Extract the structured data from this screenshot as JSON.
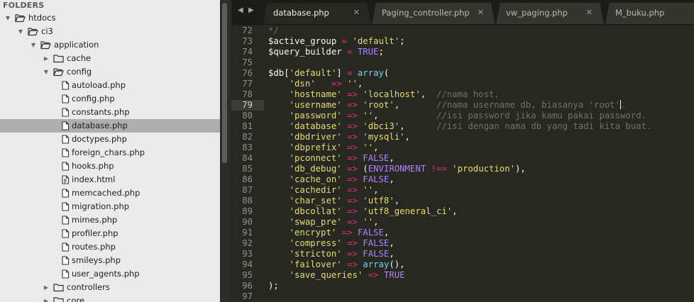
{
  "sidebar": {
    "header": "FOLDERS",
    "tree": [
      {
        "label": "htdocs",
        "type": "folder",
        "expanded": true,
        "depth": 0
      },
      {
        "label": "ci3",
        "type": "folder",
        "expanded": true,
        "depth": 1
      },
      {
        "label": "application",
        "type": "folder",
        "expanded": true,
        "depth": 2
      },
      {
        "label": "cache",
        "type": "folder",
        "expanded": false,
        "depth": 3
      },
      {
        "label": "config",
        "type": "folder",
        "expanded": true,
        "depth": 3
      },
      {
        "label": "autoload.php",
        "type": "file",
        "depth": 4
      },
      {
        "label": "config.php",
        "type": "file",
        "depth": 4
      },
      {
        "label": "constants.php",
        "type": "file",
        "depth": 4
      },
      {
        "label": "database.php",
        "type": "file",
        "depth": 4,
        "selected": true
      },
      {
        "label": "doctypes.php",
        "type": "file",
        "depth": 4
      },
      {
        "label": "foreign_chars.php",
        "type": "file",
        "depth": 4
      },
      {
        "label": "hooks.php",
        "type": "file",
        "depth": 4
      },
      {
        "label": "index.html",
        "type": "html",
        "depth": 4
      },
      {
        "label": "memcached.php",
        "type": "file",
        "depth": 4
      },
      {
        "label": "migration.php",
        "type": "file",
        "depth": 4
      },
      {
        "label": "mimes.php",
        "type": "file",
        "depth": 4
      },
      {
        "label": "profiler.php",
        "type": "file",
        "depth": 4
      },
      {
        "label": "routes.php",
        "type": "file",
        "depth": 4
      },
      {
        "label": "smileys.php",
        "type": "file",
        "depth": 4
      },
      {
        "label": "user_agents.php",
        "type": "file",
        "depth": 4
      },
      {
        "label": "controllers",
        "type": "folder",
        "expanded": false,
        "depth": 3
      },
      {
        "label": "core",
        "type": "folder",
        "expanded": false,
        "depth": 3
      }
    ]
  },
  "tabs": [
    {
      "label": "database.php",
      "active": true
    },
    {
      "label": "Paging_controller.php",
      "active": false
    },
    {
      "label": "vw_paging.php",
      "active": false
    },
    {
      "label": "M_buku.php",
      "active": false
    }
  ],
  "icons": {
    "nav_left": "◀",
    "nav_right": "▶",
    "close": "✕",
    "arrow_expanded": "▼",
    "arrow_collapsed": "▶"
  },
  "colors": {
    "string": "#e6db74",
    "keyword": "#ae81ff",
    "operator": "#f92672",
    "function": "#66d9ef",
    "comment": "#75715e",
    "plain": "#f8f8f2"
  },
  "editor": {
    "current_line": 79,
    "lines": [
      {
        "n": "72",
        "t": [
          [
            "*/",
            "comment"
          ]
        ]
      },
      {
        "n": "73",
        "t": [
          [
            "$active_group ",
            "plain"
          ],
          [
            "=",
            "operator"
          ],
          [
            " ",
            "plain"
          ],
          [
            "'default'",
            "string"
          ],
          [
            ";",
            "plain"
          ]
        ]
      },
      {
        "n": "74",
        "t": [
          [
            "$query_builder ",
            "plain"
          ],
          [
            "=",
            "operator"
          ],
          [
            " ",
            "plain"
          ],
          [
            "TRUE",
            "keyword"
          ],
          [
            ";",
            "plain"
          ]
        ]
      },
      {
        "n": "75",
        "t": []
      },
      {
        "n": "76",
        "t": [
          [
            "$db[",
            "plain"
          ],
          [
            "'default'",
            "string"
          ],
          [
            "] ",
            "plain"
          ],
          [
            "=",
            "operator"
          ],
          [
            " ",
            "plain"
          ],
          [
            "array",
            "function"
          ],
          [
            "(",
            "plain"
          ]
        ]
      },
      {
        "n": "77",
        "t": [
          [
            "    ",
            "plain"
          ],
          [
            "'dsn'",
            "string"
          ],
          [
            "   ",
            "plain"
          ],
          [
            "=>",
            "operator"
          ],
          [
            " ",
            "plain"
          ],
          [
            "''",
            "string"
          ],
          [
            ",",
            "plain"
          ]
        ]
      },
      {
        "n": "78",
        "t": [
          [
            "    ",
            "plain"
          ],
          [
            "'hostname'",
            "string"
          ],
          [
            " ",
            "plain"
          ],
          [
            "=>",
            "operator"
          ],
          [
            " ",
            "plain"
          ],
          [
            "'localhost'",
            "string"
          ],
          [
            ",  ",
            "plain"
          ],
          [
            "//nama host.",
            "comment"
          ]
        ]
      },
      {
        "n": "79",
        "t": [
          [
            "    ",
            "plain"
          ],
          [
            "'username'",
            "string"
          ],
          [
            " ",
            "plain"
          ],
          [
            "=>",
            "operator"
          ],
          [
            " ",
            "plain"
          ],
          [
            "'root'",
            "string"
          ],
          [
            ",       ",
            "plain"
          ],
          [
            "//nama username db, biasanya 'root'",
            "comment"
          ],
          [
            "|cursor|",
            "cursor"
          ],
          [
            ".",
            "comment"
          ]
        ]
      },
      {
        "n": "80",
        "t": [
          [
            "    ",
            "plain"
          ],
          [
            "'password'",
            "string"
          ],
          [
            " ",
            "plain"
          ],
          [
            "=>",
            "operator"
          ],
          [
            " ",
            "plain"
          ],
          [
            "''",
            "string"
          ],
          [
            ",           ",
            "plain"
          ],
          [
            "//isi password jika kamu pakai password.",
            "comment"
          ]
        ]
      },
      {
        "n": "81",
        "t": [
          [
            "    ",
            "plain"
          ],
          [
            "'database'",
            "string"
          ],
          [
            " ",
            "plain"
          ],
          [
            "=>",
            "operator"
          ],
          [
            " ",
            "plain"
          ],
          [
            "'dbci3'",
            "string"
          ],
          [
            ",      ",
            "plain"
          ],
          [
            "//isi dengan nama db yang tadi kita buat.",
            "comment"
          ]
        ]
      },
      {
        "n": "82",
        "t": [
          [
            "    ",
            "plain"
          ],
          [
            "'dbdriver'",
            "string"
          ],
          [
            " ",
            "plain"
          ],
          [
            "=>",
            "operator"
          ],
          [
            " ",
            "plain"
          ],
          [
            "'mysqli'",
            "string"
          ],
          [
            ",",
            "plain"
          ]
        ]
      },
      {
        "n": "83",
        "t": [
          [
            "    ",
            "plain"
          ],
          [
            "'dbprefix'",
            "string"
          ],
          [
            " ",
            "plain"
          ],
          [
            "=>",
            "operator"
          ],
          [
            " ",
            "plain"
          ],
          [
            "''",
            "string"
          ],
          [
            ",",
            "plain"
          ]
        ]
      },
      {
        "n": "84",
        "t": [
          [
            "    ",
            "plain"
          ],
          [
            "'pconnect'",
            "string"
          ],
          [
            " ",
            "plain"
          ],
          [
            "=>",
            "operator"
          ],
          [
            " ",
            "plain"
          ],
          [
            "FALSE",
            "keyword"
          ],
          [
            ",",
            "plain"
          ]
        ]
      },
      {
        "n": "85",
        "t": [
          [
            "    ",
            "plain"
          ],
          [
            "'db_debug'",
            "string"
          ],
          [
            " ",
            "plain"
          ],
          [
            "=>",
            "operator"
          ],
          [
            " (",
            "plain"
          ],
          [
            "ENVIRONMENT",
            "keyword"
          ],
          [
            " ",
            "plain"
          ],
          [
            "!==",
            "operator"
          ],
          [
            " ",
            "plain"
          ],
          [
            "'production'",
            "string"
          ],
          [
            "),",
            "plain"
          ]
        ]
      },
      {
        "n": "86",
        "t": [
          [
            "    ",
            "plain"
          ],
          [
            "'cache_on'",
            "string"
          ],
          [
            " ",
            "plain"
          ],
          [
            "=>",
            "operator"
          ],
          [
            " ",
            "plain"
          ],
          [
            "FALSE",
            "keyword"
          ],
          [
            ",",
            "plain"
          ]
        ]
      },
      {
        "n": "87",
        "t": [
          [
            "    ",
            "plain"
          ],
          [
            "'cachedir'",
            "string"
          ],
          [
            " ",
            "plain"
          ],
          [
            "=>",
            "operator"
          ],
          [
            " ",
            "plain"
          ],
          [
            "''",
            "string"
          ],
          [
            ",",
            "plain"
          ]
        ]
      },
      {
        "n": "88",
        "t": [
          [
            "    ",
            "plain"
          ],
          [
            "'char_set'",
            "string"
          ],
          [
            " ",
            "plain"
          ],
          [
            "=>",
            "operator"
          ],
          [
            " ",
            "plain"
          ],
          [
            "'utf8'",
            "string"
          ],
          [
            ",",
            "plain"
          ]
        ]
      },
      {
        "n": "89",
        "t": [
          [
            "    ",
            "plain"
          ],
          [
            "'dbcollat'",
            "string"
          ],
          [
            " ",
            "plain"
          ],
          [
            "=>",
            "operator"
          ],
          [
            " ",
            "plain"
          ],
          [
            "'utf8_general_ci'",
            "string"
          ],
          [
            ",",
            "plain"
          ]
        ]
      },
      {
        "n": "90",
        "t": [
          [
            "    ",
            "plain"
          ],
          [
            "'swap_pre'",
            "string"
          ],
          [
            " ",
            "plain"
          ],
          [
            "=>",
            "operator"
          ],
          [
            " ",
            "plain"
          ],
          [
            "''",
            "string"
          ],
          [
            ",",
            "plain"
          ]
        ]
      },
      {
        "n": "91",
        "t": [
          [
            "    ",
            "plain"
          ],
          [
            "'encrypt'",
            "string"
          ],
          [
            " ",
            "plain"
          ],
          [
            "=>",
            "operator"
          ],
          [
            " ",
            "plain"
          ],
          [
            "FALSE",
            "keyword"
          ],
          [
            ",",
            "plain"
          ]
        ]
      },
      {
        "n": "92",
        "t": [
          [
            "    ",
            "plain"
          ],
          [
            "'compress'",
            "string"
          ],
          [
            " ",
            "plain"
          ],
          [
            "=>",
            "operator"
          ],
          [
            " ",
            "plain"
          ],
          [
            "FALSE",
            "keyword"
          ],
          [
            ",",
            "plain"
          ]
        ]
      },
      {
        "n": "93",
        "t": [
          [
            "    ",
            "plain"
          ],
          [
            "'stricton'",
            "string"
          ],
          [
            " ",
            "plain"
          ],
          [
            "=>",
            "operator"
          ],
          [
            " ",
            "plain"
          ],
          [
            "FALSE",
            "keyword"
          ],
          [
            ",",
            "plain"
          ]
        ]
      },
      {
        "n": "94",
        "t": [
          [
            "    ",
            "plain"
          ],
          [
            "'failover'",
            "string"
          ],
          [
            " ",
            "plain"
          ],
          [
            "=>",
            "operator"
          ],
          [
            " ",
            "plain"
          ],
          [
            "array",
            "function"
          ],
          [
            "(),",
            "plain"
          ]
        ]
      },
      {
        "n": "95",
        "t": [
          [
            "    ",
            "plain"
          ],
          [
            "'save_queries'",
            "string"
          ],
          [
            " ",
            "plain"
          ],
          [
            "=>",
            "operator"
          ],
          [
            " ",
            "plain"
          ],
          [
            "TRUE",
            "keyword"
          ]
        ]
      },
      {
        "n": "96",
        "t": [
          [
            ");",
            "plain"
          ]
        ]
      },
      {
        "n": "97",
        "t": []
      }
    ]
  }
}
